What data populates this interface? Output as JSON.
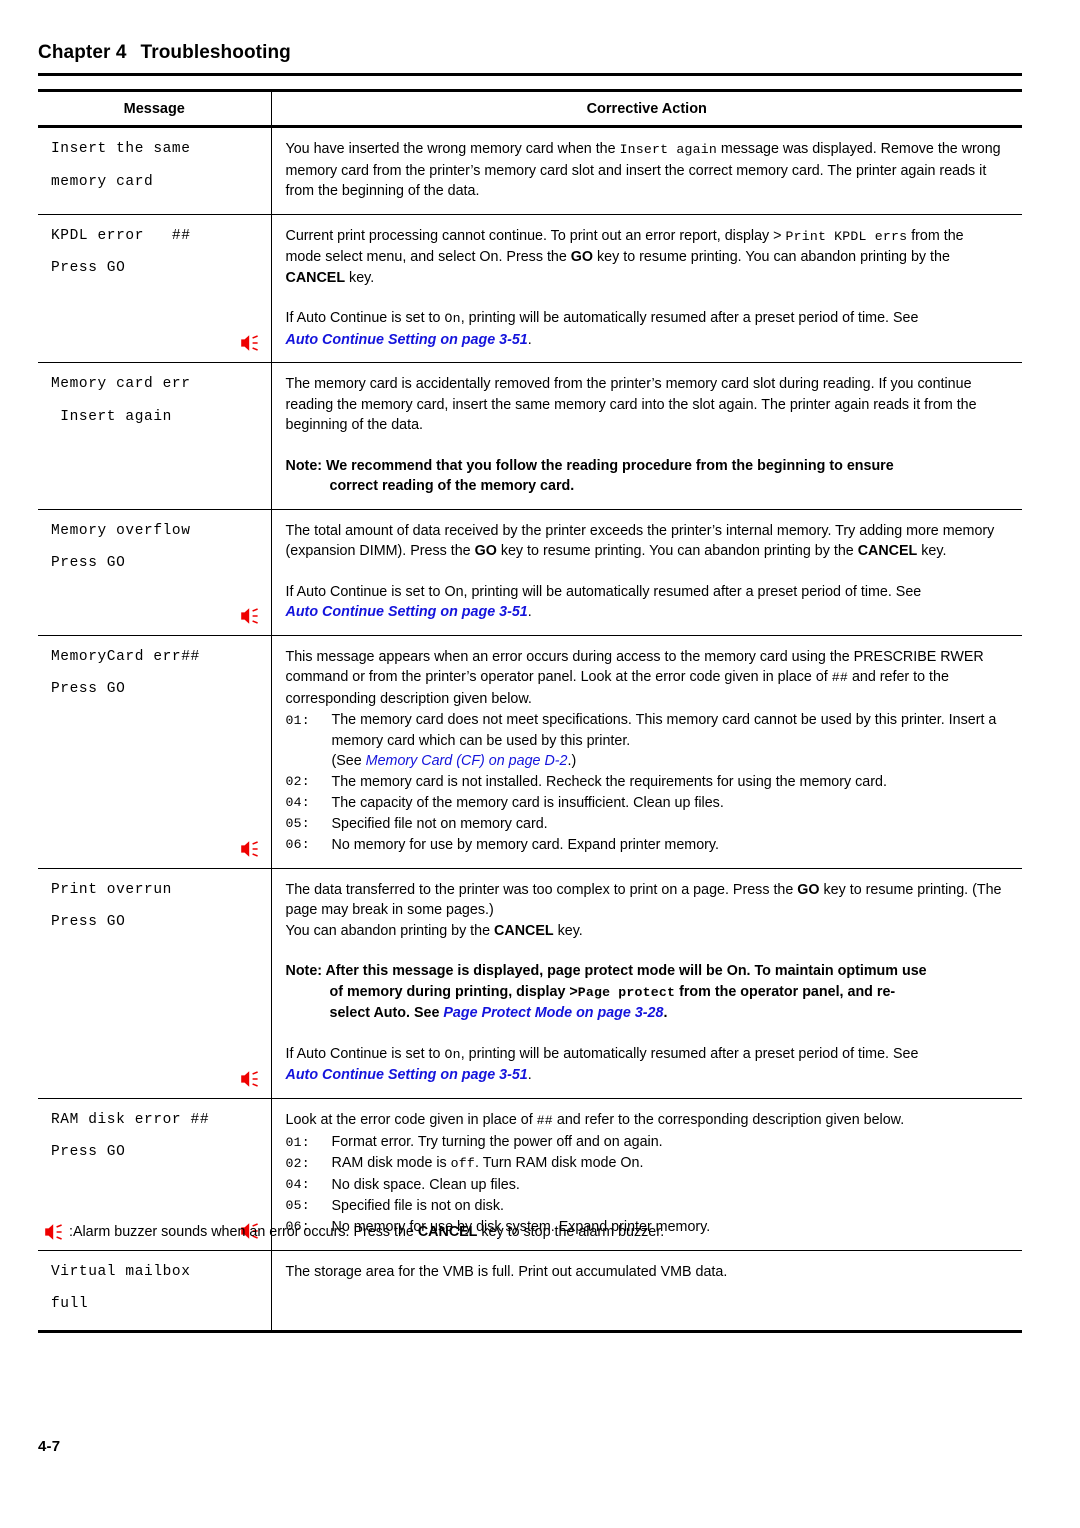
{
  "header": {
    "chapter_label": "Chapter 4",
    "chapter_title": "Troubleshooting"
  },
  "table": {
    "columns": [
      "Message",
      "Corrective Action"
    ],
    "rows": [
      {
        "message_lines": [
          "Insert the same",
          "memory card"
        ],
        "has_buzzer": false,
        "para1_a": "You have inserted the wrong memory card when the ",
        "para1_mono": "Insert again",
        "para1_b": " message was displayed. Remove the wrong memory card from the printer’s memory card slot and insert the correct memory card. The printer again reads it from the beginning of the data."
      },
      {
        "message_lines": [
          "KPDL error   ##",
          "Press GO"
        ],
        "has_buzzer": true,
        "para1_a": "Current print processing cannot continue. To print out an error report, display > ",
        "para1_mono": "Print KPDL errs",
        "para1_b": " from the mode select menu, and select On. Press the ",
        "para1_bold1": "GO",
        "para1_c": " key to resume printing. You can abandon printing by the ",
        "para1_bold2": "CANCEL",
        "para1_d": " key.",
        "auto_a": "If Auto Continue is set to ",
        "auto_mono": "On",
        "auto_b": ", printing will be automatically resumed after a preset period of time. See ",
        "auto_link": "Auto Continue Setting on page 3-51",
        "auto_c": "."
      },
      {
        "message_lines": [
          "Memory card err",
          " Insert again"
        ],
        "has_buzzer": false,
        "para1": "The memory card is accidentally removed from the printer’s memory card slot during reading. If you continue reading the memory card, insert the same memory card into the slot again. The printer again reads it from the beginning of the data.",
        "note_label": "Note:",
        "note_line1": " We recommend that you follow the reading procedure from the beginning to ensure",
        "note_line2": "correct reading of the memory card."
      },
      {
        "message_lines": [
          "Memory overflow",
          "Press GO"
        ],
        "has_buzzer": true,
        "para1_a": "The total amount of data received by the printer exceeds the printer’s internal memory. Try adding more memory (expansion DIMM). Press the ",
        "para1_bold1": "GO",
        "para1_c": " key to resume printing. You can abandon printing by the ",
        "para1_bold2": "CANCEL",
        "para1_d": " key.",
        "auto_a": "If Auto Continue is set to On, printing will be automatically resumed after a preset period of time. See ",
        "auto_link": "Auto Continue Setting on page 3-51",
        "auto_c": "."
      },
      {
        "message_lines": [
          "MemoryCard err##",
          "Press GO"
        ],
        "has_buzzer": true,
        "para1_a": "This message appears when an error occurs during access to the memory card using the PRESCRIBE RWER command or from the printer’s operator panel. Look at the error code given in place of ",
        "para1_mono": "##",
        "para1_b": " and refer to the corresponding description given below.",
        "codes": [
          {
            "num": "01:",
            "text": "The memory card does not meet specifications.  This memory card cannot be used by this printer.  Insert a memory card which can be used by this printer.",
            "sub_a": "(See ",
            "sub_link": "Memory Card (CF) on page D-2",
            "sub_b": ".)"
          },
          {
            "num": "02:",
            "text": "The memory card is not installed. Recheck the requirements for using the memory card."
          },
          {
            "num": "04:",
            "text": "The capacity of the memory card is insufficient. Clean up files."
          },
          {
            "num": "05:",
            "text": "Specified file not on memory card."
          },
          {
            "num": "06:",
            "text": "No memory for use by memory card. Expand printer memory."
          }
        ]
      },
      {
        "message_lines": [
          "Print overrun",
          "Press GO"
        ],
        "has_buzzer": true,
        "para1_a": "The data transferred to the printer was too complex to print on a page. Press the ",
        "para1_bold1": "GO",
        "para1_c": " key to resume printing. (The page may break in some pages.)",
        "para2_a": "You can abandon printing by the ",
        "para2_bold": "CANCEL",
        "para2_b": " key.",
        "note_label": "Note:",
        "note_line1": " After this message is displayed, page protect mode will be On. To maintain optimum use",
        "note_line2_a": "of memory during printing, display >",
        "note_line2_mono": "Page protect",
        "note_line2_b": " from the operator panel, and re-",
        "note_line3_a": "select Auto. See ",
        "note_line3_link": "Page Protect Mode on page 3-28",
        "note_line3_b": ".",
        "auto_a": "If Auto Continue is set to ",
        "auto_mono": "On",
        "auto_b": ", printing will be automatically resumed after a preset period of time. See ",
        "auto_link": "Auto Continue Setting on page 3-51",
        "auto_c": "."
      },
      {
        "message_lines": [
          "RAM disk error ##",
          "Press GO"
        ],
        "has_buzzer": true,
        "para1_a": "Look at the error code given in place of ",
        "para1_mono": "##",
        "para1_b": " and refer to the corresponding description given below.",
        "codes": [
          {
            "num": "01:",
            "text": "Format error. Try turning the power off and on again."
          },
          {
            "num": "02:",
            "text_a": "RAM disk mode is ",
            "text_mono": "off",
            "text_b": ". Turn RAM disk mode On."
          },
          {
            "num": "04:",
            "text": "No disk space. Clean up files."
          },
          {
            "num": "05:",
            "text": "Specified file is not on disk."
          },
          {
            "num": "06:",
            "text": "No memory for use by disk system. Expand printer memory."
          }
        ]
      },
      {
        "message_lines": [
          "Virtual mailbox",
          "full"
        ],
        "has_buzzer": false,
        "para1": "The storage area for the VMB is full. Print out accumulated VMB data."
      }
    ]
  },
  "footnote": {
    "text_a": ":Alarm buzzer sounds when an error occurs. Press the ",
    "bold": "CANCEL",
    "text_b": " key to stop the alarm buzzer."
  },
  "footer": {
    "page_number": "4-7"
  },
  "colors": {
    "buzzer_red": "#ee0000",
    "link_blue": "#1414dc",
    "rule_black": "#000000"
  }
}
